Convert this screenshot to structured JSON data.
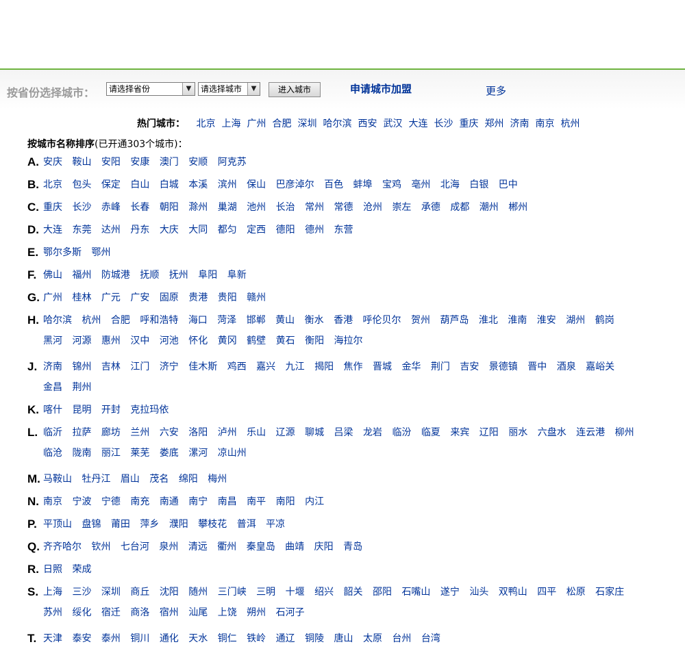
{
  "selector": {
    "label": "按省份选择城市：",
    "province_placeholder": "请选择省份",
    "city_placeholder": "请选择城市",
    "enter_button": "进入城市",
    "apply_link": "申请城市加盟",
    "more_link": "更多"
  },
  "hot": {
    "label": "热门城市：",
    "cities": [
      "北京",
      "上海",
      "广州",
      "合肥",
      "深圳",
      "哈尔滨",
      "西安",
      "武汉",
      "大连",
      "长沙",
      "重庆",
      "郑州",
      "济南",
      "南京",
      "杭州"
    ]
  },
  "sort": {
    "title": "按城市名称排序",
    "count_note": "(已开通303个城市)："
  },
  "groups": [
    {
      "letter": "A.",
      "cities": [
        "安庆",
        "鞍山",
        "安阳",
        "安康",
        "澳门",
        "安顺",
        "阿克苏"
      ]
    },
    {
      "letter": "B.",
      "cities": [
        "北京",
        "包头",
        "保定",
        "白山",
        "白城",
        "本溪",
        "滨州",
        "保山",
        "巴彦淖尔",
        "百色",
        "蚌埠",
        "宝鸡",
        "亳州",
        "北海",
        "白银",
        "巴中"
      ]
    },
    {
      "letter": "C.",
      "cities": [
        "重庆",
        "长沙",
        "赤峰",
        "长春",
        "朝阳",
        "滁州",
        "巢湖",
        "池州",
        "长治",
        "常州",
        "常德",
        "沧州",
        "崇左",
        "承德",
        "成都",
        "潮州",
        "郴州"
      ]
    },
    {
      "letter": "D.",
      "cities": [
        "大连",
        "东莞",
        "达州",
        "丹东",
        "大庆",
        "大同",
        "都匀",
        "定西",
        "德阳",
        "德州",
        "东营"
      ]
    },
    {
      "letter": "E.",
      "cities": [
        "鄂尔多斯",
        "鄂州"
      ]
    },
    {
      "letter": "F.",
      "cities": [
        "佛山",
        "福州",
        "防城港",
        "抚顺",
        "抚州",
        "阜阳",
        "阜新"
      ]
    },
    {
      "letter": "G.",
      "cities": [
        "广州",
        "桂林",
        "广元",
        "广安",
        "固原",
        "贵港",
        "贵阳",
        "赣州"
      ]
    },
    {
      "letter": "H.",
      "cities": [
        "哈尔滨",
        "杭州",
        "合肥",
        "呼和浩特",
        "海口",
        "菏泽",
        "邯郸",
        "黄山",
        "衡水",
        "香港",
        "呼伦贝尔",
        "贺州",
        "葫芦岛",
        "淮北",
        "淮南",
        "淮安",
        "湖州",
        "鹤岗",
        "黑河",
        "河源",
        "惠州",
        "汉中",
        "河池",
        "怀化",
        "黄冈",
        "鹤壁",
        "黄石",
        "衡阳",
        "海拉尔"
      ]
    },
    {
      "letter": "J.",
      "cities": [
        "济南",
        "锦州",
        "吉林",
        "江门",
        "济宁",
        "佳木斯",
        "鸡西",
        "嘉兴",
        "九江",
        "揭阳",
        "焦作",
        "晋城",
        "金华",
        "荆门",
        "吉安",
        "景德镇",
        "晋中",
        "酒泉",
        "嘉峪关",
        "金昌",
        "荆州"
      ]
    },
    {
      "letter": "K.",
      "cities": [
        "喀什",
        "昆明",
        "开封",
        "克拉玛依"
      ]
    },
    {
      "letter": "L.",
      "cities": [
        "临沂",
        "拉萨",
        "廊坊",
        "兰州",
        "六安",
        "洛阳",
        "泸州",
        "乐山",
        "辽源",
        "聊城",
        "吕梁",
        "龙岩",
        "临汾",
        "临夏",
        "来宾",
        "辽阳",
        "丽水",
        "六盘水",
        "连云港",
        "柳州",
        "临沧",
        "陇南",
        "丽江",
        "莱芜",
        "娄底",
        "漯河",
        "凉山州"
      ]
    },
    {
      "letter": "M.",
      "cities": [
        "马鞍山",
        "牡丹江",
        "眉山",
        "茂名",
        "绵阳",
        "梅州"
      ]
    },
    {
      "letter": "N.",
      "cities": [
        "南京",
        "宁波",
        "宁德",
        "南充",
        "南通",
        "南宁",
        "南昌",
        "南平",
        "南阳",
        "内江"
      ]
    },
    {
      "letter": "P.",
      "cities": [
        "平顶山",
        "盘锦",
        "莆田",
        "萍乡",
        "濮阳",
        "攀枝花",
        "普洱",
        "平凉"
      ]
    },
    {
      "letter": "Q.",
      "cities": [
        "齐齐哈尔",
        "钦州",
        "七台河",
        "泉州",
        "清远",
        "衢州",
        "秦皇岛",
        "曲靖",
        "庆阳",
        "青岛"
      ]
    },
    {
      "letter": "R.",
      "cities": [
        "日照",
        "荣成"
      ]
    },
    {
      "letter": "S.",
      "cities": [
        "上海",
        "三沙",
        "深圳",
        "商丘",
        "沈阳",
        "随州",
        "三门峡",
        "三明",
        "十堰",
        "绍兴",
        "韶关",
        "邵阳",
        "石嘴山",
        "遂宁",
        "汕头",
        "双鸭山",
        "四平",
        "松原",
        "石家庄",
        "苏州",
        "绥化",
        "宿迁",
        "商洛",
        "宿州",
        "汕尾",
        "上饶",
        "朔州",
        "石河子"
      ]
    },
    {
      "letter": "T.",
      "cities": [
        "天津",
        "泰安",
        "泰州",
        "铜川",
        "通化",
        "天水",
        "铜仁",
        "铁岭",
        "通辽",
        "铜陵",
        "唐山",
        "太原",
        "台州",
        "台湾"
      ]
    }
  ]
}
